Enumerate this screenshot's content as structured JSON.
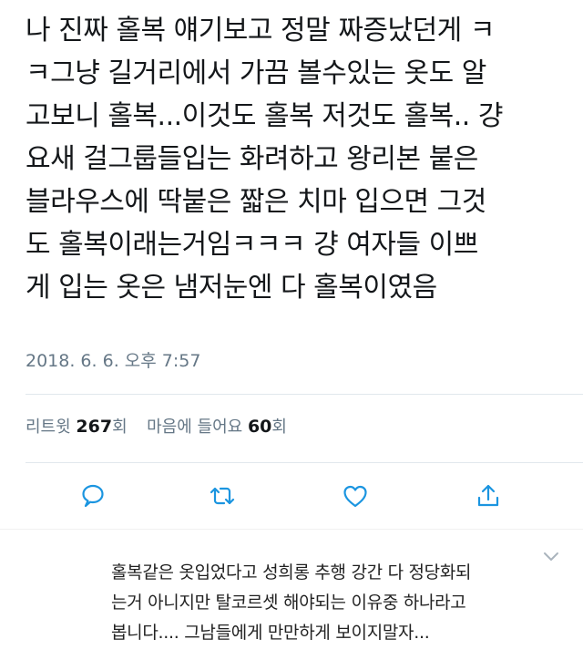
{
  "tweet": {
    "text_lines": [
      "나 진짜 홀복 얘기보고 정말 짜증났던게 ㅋ",
      "ㅋ그냥 길거리에서 가끔 볼수있는 옷도 알",
      "고보니 홀복...이것도 홀복 저것도 홀복.. 걍",
      "요새 걸그룹들입는 화려하고 왕리본 붙은",
      "블라우스에 딱붙은 짧은 치마 입으면 그것",
      "도 홀복이래는거임ㅋㅋㅋ 걍 여자들 이쁘",
      "게 입는 옷은 냄저눈엔 다 홀복이였음"
    ],
    "timestamp": "2018. 6. 6. 오후 7:57",
    "stats": {
      "retweet_label": "리트윗",
      "retweet_count": "267",
      "retweet_unit": "회",
      "like_label": "마음에 들어요",
      "like_count": "60",
      "like_unit": "회"
    },
    "actions": [
      {
        "icon": "reply-icon"
      },
      {
        "icon": "retweet-icon"
      },
      {
        "icon": "like-icon"
      },
      {
        "icon": "share-icon"
      }
    ]
  },
  "comment": {
    "text_lines": [
      "홀복같은 옷입었다고 성희롱 추행 강간 다 정당화되",
      "는거 아니지만 탈코르셋 해야되는 이유중 하나라고",
      "봅니다.... 그남들에게 만만하게 보이지말자..."
    ],
    "menu_icon": "chevron-down-icon"
  },
  "colors": {
    "text": "#14171a",
    "secondary": "#657786",
    "icon": "#1b95e0",
    "divider": "#e1e8ed"
  }
}
